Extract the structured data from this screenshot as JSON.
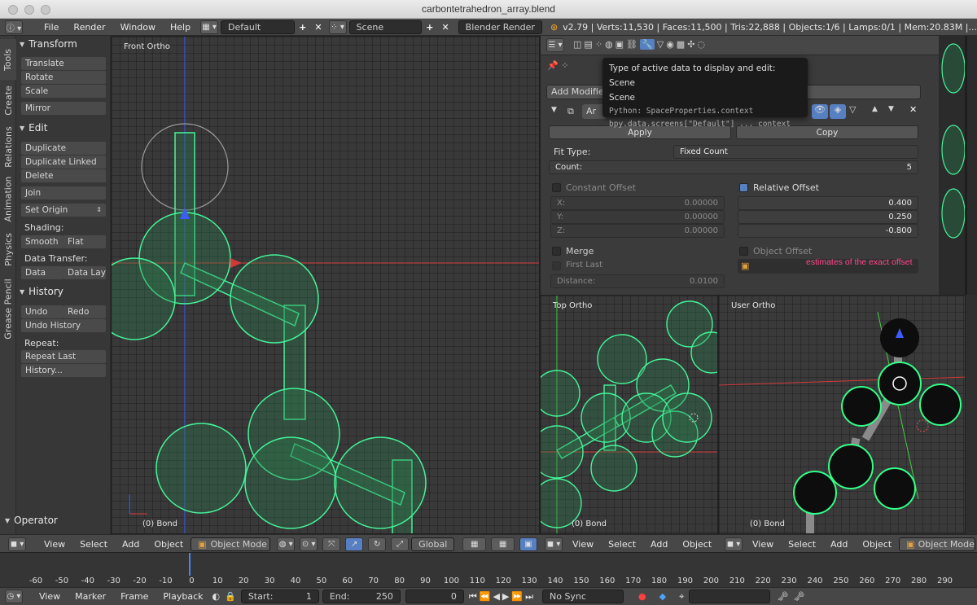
{
  "window": {
    "title": "carbontetrahedron_array.blend"
  },
  "info_header": {
    "menus": [
      "File",
      "Render",
      "Window",
      "Help"
    ],
    "screen_layout": "Default",
    "scene": "Scene",
    "engine": "Blender Render",
    "stats": "v2.79 | Verts:11,530 | Faces:11,500 | Tris:22,888 | Objects:1/6 | Lamps:0/1 | Mem:20.83M |..."
  },
  "toolshelf": {
    "tabs": [
      "Tools",
      "Create",
      "Relations",
      "Animation",
      "Physics",
      "Grease Pencil"
    ],
    "transform": {
      "title": "Transform",
      "buttons": [
        "Translate",
        "Rotate",
        "Scale",
        "Mirror"
      ]
    },
    "edit": {
      "title": "Edit",
      "buttons": [
        "Duplicate",
        "Duplicate Linked",
        "Delete",
        "Join",
        "Set Origin"
      ]
    },
    "shading": {
      "label": "Shading:",
      "smooth": "Smooth",
      "flat": "Flat"
    },
    "data_transfer": {
      "label": "Data Transfer:",
      "data": "Data",
      "data_layout": "Data Lay"
    },
    "history": {
      "title": "History",
      "undo": "Undo",
      "redo": "Redo",
      "undo_history": "Undo History",
      "repeat_label": "Repeat:",
      "repeat_last": "Repeat Last",
      "history": "History..."
    },
    "operator": "Operator"
  },
  "viewports": {
    "front": {
      "label": "Front Ortho",
      "object": "(0) Bond"
    },
    "top": {
      "label": "Top Ortho",
      "object": "(0) Bond"
    },
    "user": {
      "label": "User Ortho",
      "object": "(0) Bond"
    }
  },
  "view3d_header": {
    "menus": [
      "View",
      "Select",
      "Add",
      "Object"
    ],
    "mode": "Object Mode",
    "orientation": "Global"
  },
  "properties": {
    "add_modifier": "Add Modifier",
    "modifier_name_partial": "Ar",
    "apply": "Apply",
    "copy": "Copy",
    "fit_type_label": "Fit Type:",
    "fit_type_value": "Fixed Count",
    "count_label": "Count:",
    "count_value": "5",
    "constant_offset": {
      "label": "Constant Offset",
      "checked": false,
      "x_label": "X:",
      "x": "0.00000",
      "y_label": "Y:",
      "y": "0.00000",
      "z_label": "Z:",
      "z": "0.00000"
    },
    "relative_offset": {
      "label": "Relative Offset",
      "checked": true,
      "x": "0.400",
      "y": "0.250",
      "z": "-0.800"
    },
    "merge": {
      "label": "Merge",
      "checked": false
    },
    "first_last": "First Last",
    "distance_label": "Distance:",
    "distance_value": "0.0100",
    "object_offset": {
      "label": "Object Offset",
      "checked": false
    }
  },
  "tooltip": {
    "line1": "Type of active data to display and edit:  Scene",
    "line2": "Scene",
    "line3": "Python: SpaceProperties.context",
    "line4": "bpy.data.screens[\"Default\"] ... context"
  },
  "annotation": "estimates of the exact offset",
  "timeline": {
    "ticks": [
      "-60",
      "-50",
      "-40",
      "-30",
      "-20",
      "-10",
      "0",
      "10",
      "20",
      "30",
      "40",
      "50",
      "60",
      "70",
      "80",
      "90",
      "100",
      "110",
      "120",
      "130",
      "140",
      "150",
      "160",
      "170",
      "180",
      "190",
      "200",
      "210",
      "220",
      "230",
      "240",
      "250",
      "260",
      "270",
      "280",
      "290"
    ],
    "menus": [
      "View",
      "Marker",
      "Frame",
      "Playback"
    ],
    "start_label": "Start:",
    "start_value": "1",
    "end_label": "End:",
    "end_value": "250",
    "current_frame": "0",
    "sync": "No Sync"
  },
  "colors": {
    "wire": "#44f59a",
    "accent": "#5680c2",
    "annotation": "#ff4a8c",
    "cursor": "#4a82ff"
  }
}
